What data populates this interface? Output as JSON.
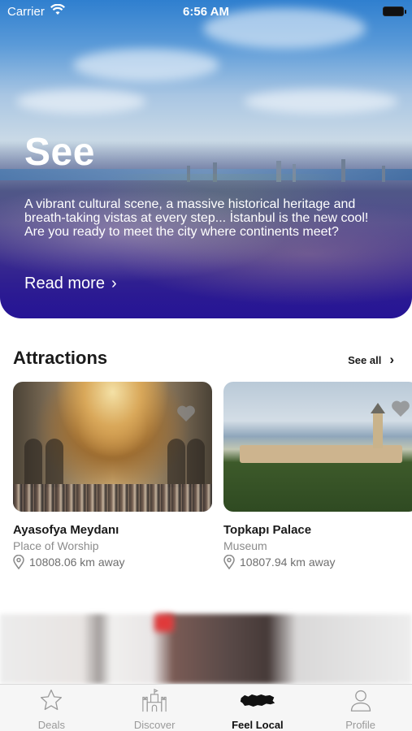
{
  "status_bar": {
    "carrier": "Carrier",
    "time": "6:56 AM"
  },
  "hero": {
    "title": "See",
    "description": "A vibrant cultural scene, a massive historical heritage and breath-taking vistas at every step... İstanbul is the new cool! Are you ready to meet the city where continents meet?",
    "read_more": "Read more"
  },
  "attractions": {
    "title": "Attractions",
    "see_all": "See all",
    "items": [
      {
        "name": "Ayasofya Meydanı",
        "category": "Place of Worship",
        "distance": "10808.06 km away",
        "favorited": false
      },
      {
        "name": "Topkapı Palace",
        "category": "Museum",
        "distance": "10807.94 km away",
        "favorited": false
      }
    ]
  },
  "tabs": [
    {
      "label": "Deals",
      "icon": "star-icon",
      "active": false
    },
    {
      "label": "Discover",
      "icon": "castle-icon",
      "active": false
    },
    {
      "label": "Feel Local",
      "icon": "turkey-map-icon",
      "active": true
    },
    {
      "label": "Profile",
      "icon": "person-icon",
      "active": false
    }
  ],
  "colors": {
    "hero_gradient_bottom": "#2b1b8a",
    "tab_active": "#111111",
    "tab_inactive": "#9a9a9a"
  }
}
